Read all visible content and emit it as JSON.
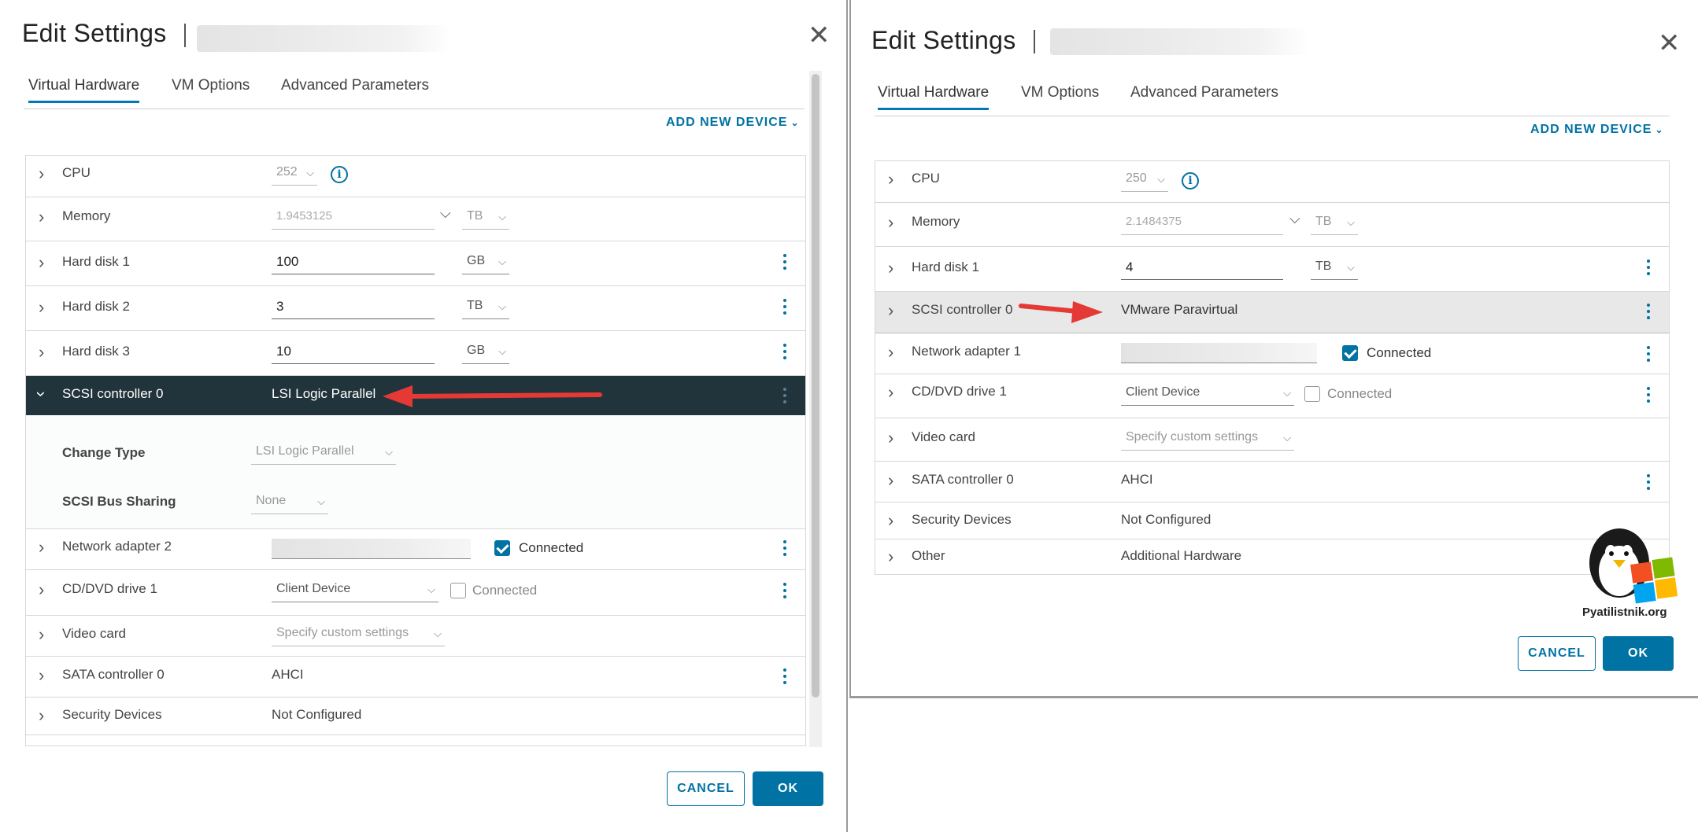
{
  "left_dialog": {
    "title": "Edit Settings",
    "tabs": [
      "Virtual Hardware",
      "VM Options",
      "Advanced Parameters"
    ],
    "add_new_device": "ADD NEW DEVICE",
    "rows": {
      "cpu": {
        "label": "CPU",
        "value": "252"
      },
      "memory": {
        "label": "Memory",
        "value": "1.9453125",
        "unit": "TB"
      },
      "hd1": {
        "label": "Hard disk 1",
        "value": "100",
        "unit": "GB"
      },
      "hd2": {
        "label": "Hard disk 2",
        "value": "3",
        "unit": "TB"
      },
      "hd3": {
        "label": "Hard disk 3",
        "value": "10",
        "unit": "GB"
      },
      "scsi": {
        "label": "SCSI controller 0",
        "value": "LSI Logic Parallel"
      },
      "change_type": {
        "label": "Change Type",
        "value": "LSI Logic Parallel"
      },
      "bus_sharing": {
        "label": "SCSI Bus Sharing",
        "value": "None"
      },
      "net2": {
        "label": "Network adapter 2",
        "connected": "Connected"
      },
      "cdvd": {
        "label": "CD/DVD drive 1",
        "value": "Client Device",
        "connected": "Connected"
      },
      "video": {
        "label": "Video card",
        "value": "Specify custom settings"
      },
      "sata": {
        "label": "SATA controller 0",
        "value": "AHCI"
      },
      "security": {
        "label": "Security Devices",
        "value": "Not Configured"
      }
    },
    "cancel": "CANCEL",
    "ok": "OK"
  },
  "right_dialog": {
    "title": "Edit Settings",
    "tabs": [
      "Virtual Hardware",
      "VM Options",
      "Advanced Parameters"
    ],
    "add_new_device": "ADD NEW DEVICE",
    "rows": {
      "cpu": {
        "label": "CPU",
        "value": "250"
      },
      "memory": {
        "label": "Memory",
        "value": "2.1484375",
        "unit": "TB"
      },
      "hd1": {
        "label": "Hard disk 1",
        "value": "4",
        "unit": "TB"
      },
      "scsi": {
        "label": "SCSI controller 0",
        "value": "VMware Paravirtual"
      },
      "net1": {
        "label": "Network adapter 1",
        "connected": "Connected"
      },
      "cdvd": {
        "label": "CD/DVD drive 1",
        "value": "Client Device",
        "connected": "Connected"
      },
      "video": {
        "label": "Video card",
        "value": "Specify custom settings"
      },
      "sata": {
        "label": "SATA controller 0",
        "value": "AHCI"
      },
      "security": {
        "label": "Security Devices",
        "value": "Not Configured"
      },
      "other": {
        "label": "Other",
        "value": "Additional Hardware"
      }
    },
    "cancel": "CANCEL",
    "ok": "OK"
  },
  "watermark": "Pyatilistnik.org",
  "colors": {
    "accent": "#0072a3",
    "dark_row": "#21333b",
    "arrow": "#e53935"
  }
}
